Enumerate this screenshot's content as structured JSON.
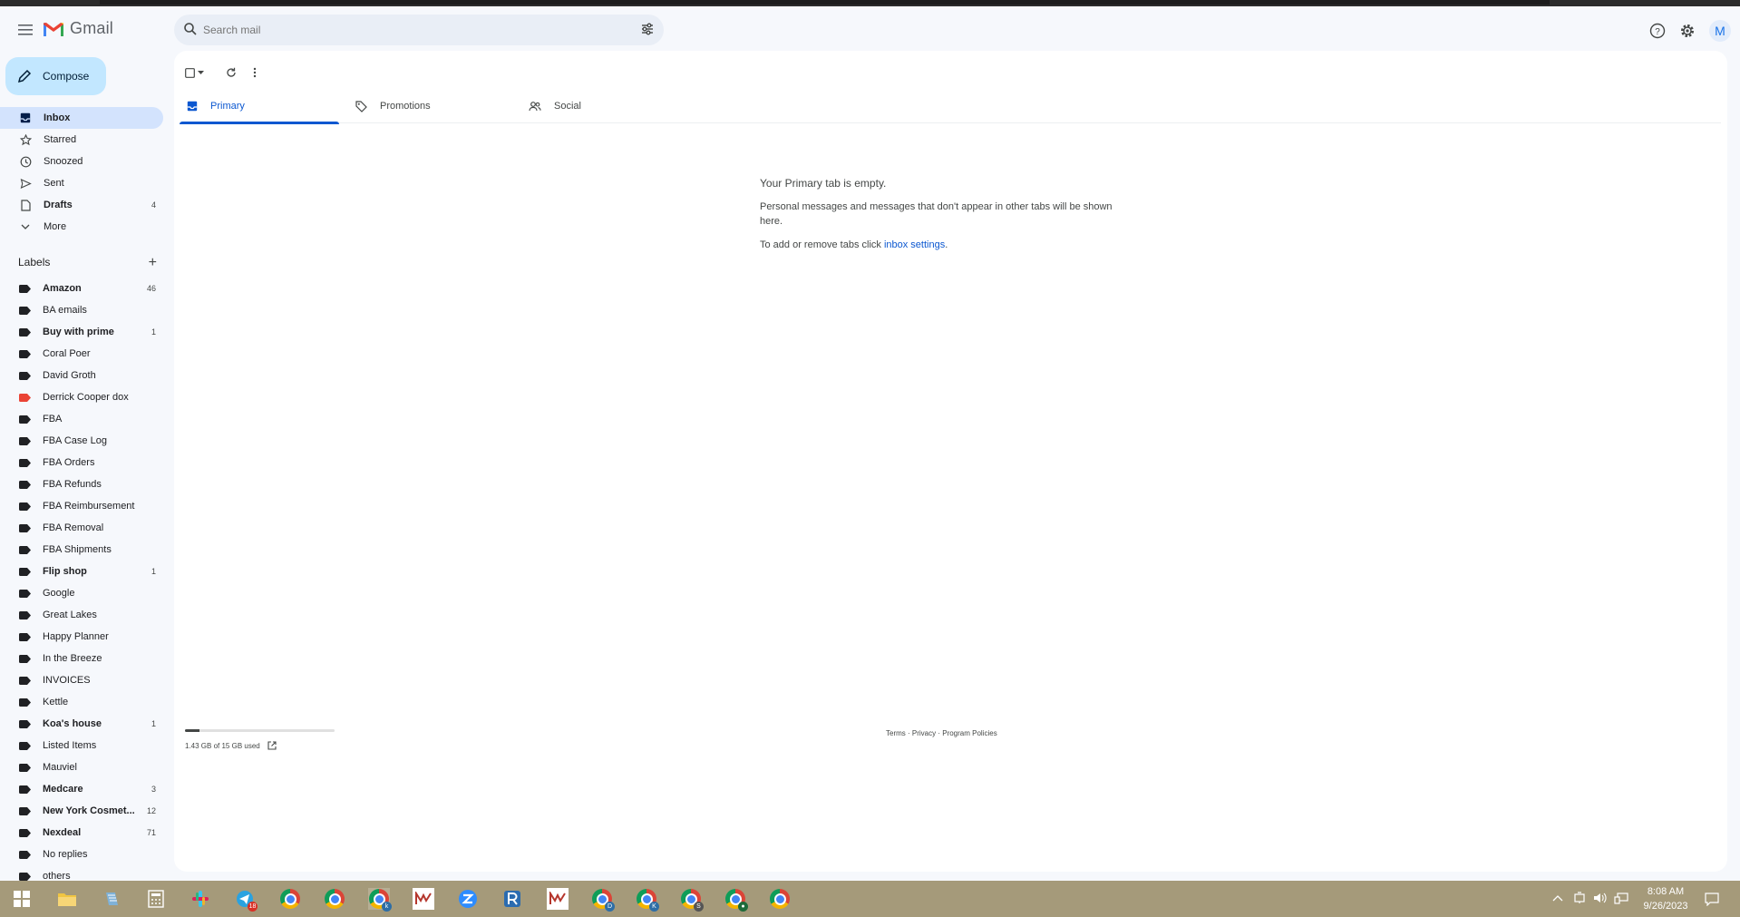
{
  "app": {
    "name": "Gmail"
  },
  "search": {
    "placeholder": "Search mail"
  },
  "user": {
    "avatar_letter": "M"
  },
  "compose": {
    "label": "Compose"
  },
  "nav": [
    {
      "label": "Inbox",
      "icon": "inbox-icon",
      "count": "",
      "active": true
    },
    {
      "label": "Starred",
      "icon": "star-icon",
      "count": ""
    },
    {
      "label": "Snoozed",
      "icon": "clock-icon",
      "count": ""
    },
    {
      "label": "Sent",
      "icon": "send-icon",
      "count": ""
    },
    {
      "label": "Drafts",
      "icon": "draft-icon",
      "count": "4",
      "bold": true
    },
    {
      "label": "More",
      "icon": "chevron-down-icon",
      "count": ""
    }
  ],
  "labels": {
    "title": "Labels",
    "items": [
      {
        "label": "Amazon",
        "count": "46",
        "bold": true,
        "color": "#202124"
      },
      {
        "label": "BA emails",
        "count": "",
        "color": "#202124"
      },
      {
        "label": "Buy with prime",
        "count": "1",
        "bold": true,
        "color": "#202124"
      },
      {
        "label": "Coral Poer",
        "count": "",
        "color": "#202124"
      },
      {
        "label": "David Groth",
        "count": "",
        "color": "#202124"
      },
      {
        "label": "Derrick Cooper dox",
        "count": "",
        "color": "#ea4335"
      },
      {
        "label": "FBA",
        "count": "",
        "color": "#202124"
      },
      {
        "label": "FBA Case Log",
        "count": "",
        "color": "#202124"
      },
      {
        "label": "FBA Orders",
        "count": "",
        "color": "#202124"
      },
      {
        "label": "FBA Refunds",
        "count": "",
        "color": "#202124"
      },
      {
        "label": "FBA Reimbursement",
        "count": "",
        "color": "#202124"
      },
      {
        "label": "FBA Removal",
        "count": "",
        "color": "#202124"
      },
      {
        "label": "FBA Shipments",
        "count": "",
        "color": "#202124"
      },
      {
        "label": "Flip shop",
        "count": "1",
        "bold": true,
        "color": "#202124"
      },
      {
        "label": "Google",
        "count": "",
        "color": "#202124"
      },
      {
        "label": "Great Lakes",
        "count": "",
        "color": "#202124"
      },
      {
        "label": "Happy Planner",
        "count": "",
        "color": "#202124"
      },
      {
        "label": "In the Breeze",
        "count": "",
        "color": "#202124"
      },
      {
        "label": "INVOICES",
        "count": "",
        "color": "#202124"
      },
      {
        "label": "Kettle",
        "count": "",
        "color": "#202124"
      },
      {
        "label": "Koa's house",
        "count": "1",
        "bold": true,
        "color": "#202124"
      },
      {
        "label": "Listed Items",
        "count": "",
        "color": "#202124"
      },
      {
        "label": "Mauviel",
        "count": "",
        "color": "#202124"
      },
      {
        "label": "Medcare",
        "count": "3",
        "bold": true,
        "color": "#202124"
      },
      {
        "label": "New York Cosmet...",
        "count": "12",
        "bold": true,
        "color": "#202124"
      },
      {
        "label": "Nexdeal",
        "count": "71",
        "bold": true,
        "color": "#202124"
      },
      {
        "label": "No replies",
        "count": "",
        "color": "#202124"
      },
      {
        "label": "others",
        "count": "",
        "color": "#202124"
      }
    ]
  },
  "tabs": [
    {
      "label": "Primary",
      "icon": "inbox-icon",
      "active": true
    },
    {
      "label": "Promotions",
      "icon": "tag-icon"
    },
    {
      "label": "Social",
      "icon": "people-icon"
    }
  ],
  "empty_state": {
    "title": "Your Primary tab is empty.",
    "body": "Personal messages and messages that don't appear in other tabs will be shown here.",
    "settings_prefix": "To add or remove tabs click ",
    "settings_link": "inbox settings",
    "settings_suffix": "."
  },
  "storage": {
    "text": "1.43 GB of 15 GB used",
    "used_fraction": 0.095
  },
  "footer": {
    "terms": "Terms",
    "privacy": "Privacy",
    "policies": "Program Policies",
    "sep": " · "
  },
  "taskbar": {
    "time": "8:08 AM",
    "date": "9/26/2023",
    "badges": {
      "mail_count": "18",
      "chrome_k": "k",
      "chrome_d": "D",
      "chrome_k2": "K",
      "chrome_s": "S",
      "chrome_dot": "●"
    }
  },
  "colors": {
    "accent": "#0b57d0",
    "compose_bg": "#c2e7ff",
    "active_nav": "#d3e3fd",
    "taskbar": "#a59a7a"
  }
}
